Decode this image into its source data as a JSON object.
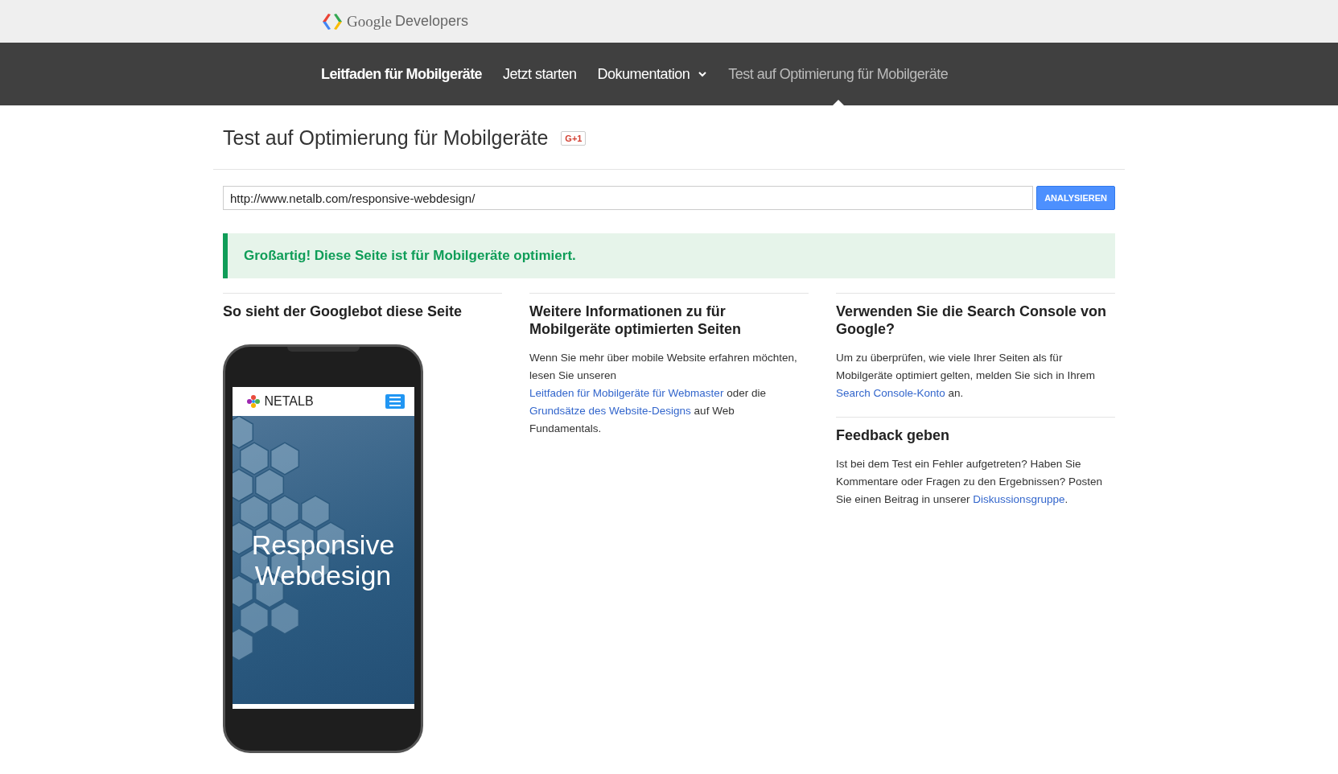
{
  "header": {
    "logo_text_1": "Google",
    "logo_text_2": "Developers"
  },
  "nav": {
    "title": "Leitfaden für Mobilgeräte",
    "items": [
      {
        "label": "Jetzt starten",
        "kind": "link",
        "selected": false
      },
      {
        "label": "Dokumentation",
        "kind": "dropdown",
        "selected": false
      },
      {
        "label": "Test auf Optimierung für Mobilgeräte",
        "kind": "link",
        "selected": true
      }
    ]
  },
  "page_title": "Test auf Optimierung für Mobilgeräte",
  "plus_button": "G+1",
  "url_field": {
    "value": "http://www.netalb.com/responsive-webdesign/"
  },
  "analyze_button": "ANALYSIEREN",
  "result_message": "Großartig! Diese Seite ist für Mobilgeräte optimiert.",
  "preview": {
    "heading": "So sieht der Googlebot diese Seite",
    "site_logo": "NETALB",
    "hero_text": "Responsive Webdesign"
  },
  "columns": [
    {
      "sections": [
        {
          "heading": "Weitere Informationen zu für Mobilgeräte optimierten Seiten",
          "paragraph": [
            {
              "text": "Wenn Sie mehr über mobile Website erfahren möchten, lesen Sie unseren ",
              "kind": "text"
            },
            {
              "text": "Leitfaden für Mobilgeräte für Webmaster",
              "kind": "link"
            },
            {
              "text": " oder die ",
              "kind": "text"
            },
            {
              "text": "Grundsätze des Website-Designs",
              "kind": "link"
            },
            {
              "text": " auf Web Fundamentals.",
              "kind": "text"
            }
          ]
        }
      ]
    },
    {
      "sections": [
        {
          "heading": "Verwenden Sie die Search Console von Google?",
          "paragraph": [
            {
              "text": "Um zu überprüfen, wie viele Ihrer Seiten als für Mobilgeräte optimiert gelten, melden Sie sich in Ihrem ",
              "kind": "text"
            },
            {
              "text": "Search Console-Konto",
              "kind": "link"
            },
            {
              "text": " an.",
              "kind": "text"
            }
          ]
        },
        {
          "heading": "Feedback geben",
          "paragraph": [
            {
              "text": "Ist bei dem Test ein Fehler aufgetreten? Haben Sie Kommentare oder Fragen zu den Ergebnissen? Posten Sie einen Beitrag in unserer ",
              "kind": "text"
            },
            {
              "text": "Diskussionsgruppe",
              "kind": "link"
            },
            {
              "text": ".",
              "kind": "text"
            }
          ]
        }
      ]
    }
  ]
}
